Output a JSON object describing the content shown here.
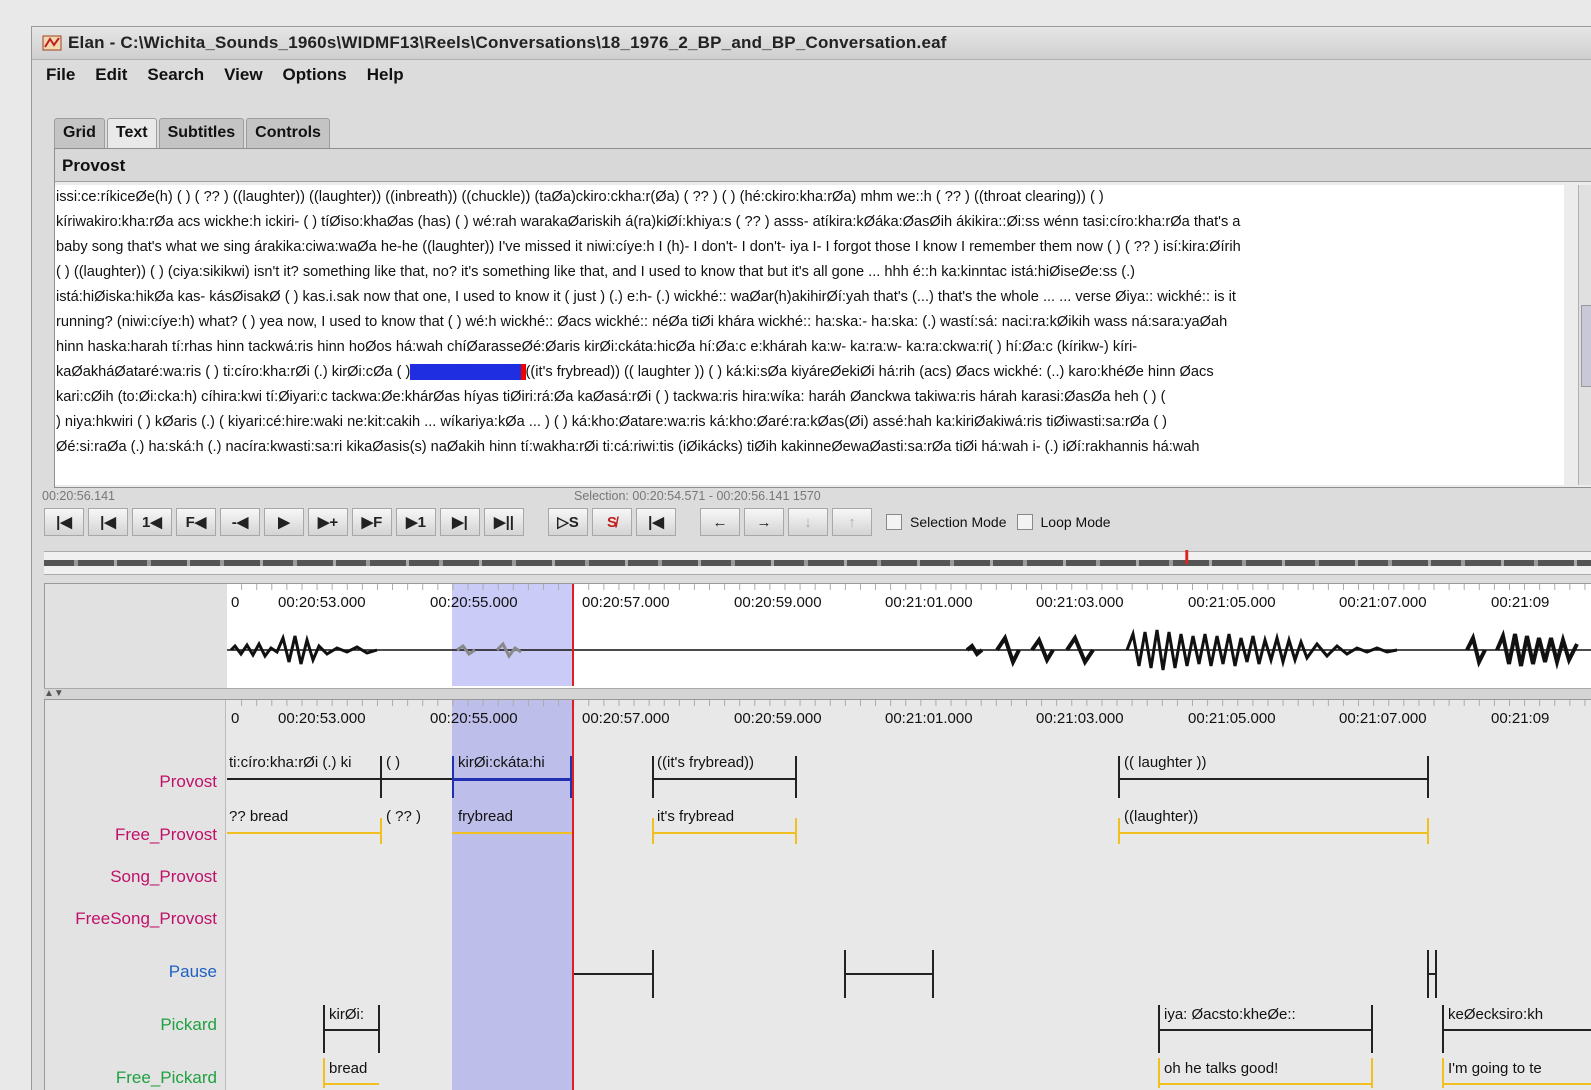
{
  "window": {
    "title": "Elan - C:\\Wichita_Sounds_1960s\\WIDMF13\\Reels\\Conversations\\18_1976_2_BP_and_BP_Conversation.eaf"
  },
  "menu": [
    "File",
    "Edit",
    "Search",
    "View",
    "Options",
    "Help"
  ],
  "tabs": [
    "Grid",
    "Text",
    "Subtitles",
    "Controls"
  ],
  "text_view": {
    "tier": "Provost",
    "lines": [
      "issi:ce:ríkiceØe(h) ( ) ( ?? ) ((laughter)) ((laughter)) ((inbreath)) ((chuckle)) (taØa)ckiro:ckha:r(Øa) ( ?? ) ( ) (hé:ckiro:kha:rØa) mhm we::h ( ?? ) ((throat clearing)) ( )",
      "kíriwakiro:kha:rØa acs wickhe:h ickiri- ( ) tíØiso:khaØas (has) ( ) wé:rah warakaØariskih á(ra)kiØí:khiya:s ( ?? ) asss- atíkira:kØáka:ØasØih ákikira::Øi:ss wénn tasi:círo:kha:rØa that's a",
      "baby song that's what we sing árakika:ciwa:waØa he-he ((laughter)) I've missed it niwi:cíye:h I (h)- I don't- I don't- iya I- I forgot those I know I remember them now ( ) ( ?? ) isí:kira:Øírih",
      "( ) ((laughter)) ( ) (ciya:sikikwi) isn't it? something like that, no? it's something like that, and I used to know that but it's all gone ... hhh é::h ka:kinntac istá:hiØiseØe:ss (.)",
      "istá:hiØiska:hikØa kas- kásØisakØ ( ) kas.i.sak now that one, I used to know it ( just ) (.) e:h- (.) wickhé:: waØar(h)akihirØí:yah that's (...) that's the whole ... ... verse Øiya:: wickhé:: is it",
      "running? (niwi:cíye:h) what? ( ) yea now, I used to know that ( ) wé:h wickhé:: Øacs wickhé:: néØa tiØi khára wickhé:: ha:ska:- ha:ska: (.) wastí:sá: naci:ra:kØikih wass ná:sara:yaØah",
      "hinn haska:harah tí:rhas hinn tackwá:ris hinn hoØos há:wah chíØarasseØé:Øaris kirØi:ckáta:hicØa hí:Øa:c e:khárah ka:w- ka:ra:w- ka:ra:ckwa:ri( ) hí:Øa:c (kírikw-) kíri-",
      "kaØakháØataré:wa:ris ( ) ti:círo:kha:rØi (.) kirØi:cØa ( )",
      "kari:cØih (to:Øi:cka:h) cíhira:kwi tí:Øiyari:c tackwa:Øe:khárØas híyas tiØiri:rá:Øa kaØasá:rØi ( ) tackwa:ris hira:wíka: haráh Øanckwa takiwa:ris hárah karasi:ØasØa heh ( ) (",
      " ) niya:hkwiri ( ) kØaris (.) ( kiyari:cé:hire:waki ne:kit:cakih ... wíkariya:kØa ... ) ( ) ká:kho:Øatare:wa:ris ká:kho:Øaré:ra:kØas(Øi) assé:hah ka:kiriØakiwá:ris tiØiwasti:sa:rØa ( )",
      "Øé:si:raØa (.) ha:ská:h (.) nacíra:kwasti:sa:ri kikaØasis(s) naØakih hinn tí:wakha:rØi ti:cá:riwi:tis (iØikácks) tiØih kakinneØewaØasti:sa:rØa tiØi há:wah i- (.) iØí:rakhannis há:wah"
    ],
    "selected_segment": "kirØi:ckáta:hicØa",
    "line8_after": "((it's frybread)) (( laughter )) ( ) ká:ki:sØa kiyáreØekiØi há:rih (acs) Øacs wickhé: (..) karo:khéØe hinn Øacs"
  },
  "status": {
    "time": "00:20:56.141",
    "selection": "Selection: 00:20:54.571 - 00:20:56.141 1570"
  },
  "controls": {
    "buttons": [
      "|◀",
      "|◀",
      "1◀",
      "F◀",
      "-◀",
      "▶",
      "▶+",
      "▶F",
      "▶1",
      "▶|",
      "▶||"
    ],
    "sel_buttons": [
      "▷S",
      "S̸",
      "|◀"
    ],
    "nav_buttons": [
      "←",
      "→",
      "↓",
      "↑"
    ],
    "selection_mode": "Selection Mode",
    "loop_mode": "Loop Mode"
  },
  "ruler_labels": [
    "00:20:53.000",
    "00:20:55.000",
    "00:20:57.000",
    "00:20:59.000",
    "00:21:01.000",
    "00:21:03.000",
    "00:21:05.000",
    "00:21:07.000",
    "00:21:09"
  ],
  "ruler_labels_tiers": [
    "00:20:53.000",
    "00:20:55.000",
    "00:20:57.000",
    "00:20:59.000",
    "00:21:01.000",
    "00:21:03.000",
    "00:21:05.000",
    "00:21:07.000",
    "00:21:09"
  ],
  "ruler_lead": "0",
  "tiers": [
    {
      "name": "Provost",
      "color": "#c0106a"
    },
    {
      "name": "Free_Provost",
      "color": "#c0106a"
    },
    {
      "name": "Song_Provost",
      "color": "#c0106a"
    },
    {
      "name": "FreeSong_Provost",
      "color": "#c0106a"
    },
    {
      "name": "Pause",
      "color": "#2060c0"
    },
    {
      "name": "Pickard",
      "color": "#20a040"
    },
    {
      "name": "Free_Pickard",
      "color": "#20a040"
    }
  ],
  "annotations": {
    "provost_1": "ti:círo:kha:rØi (.) ki",
    "provost_2": "( )",
    "provost_3": "kirØi:ckáta:hi",
    "provost_4": "((it's frybread))",
    "provost_5": "(( laughter ))",
    "free_1": "?? bread",
    "free_2": "( ?? )",
    "free_3": "frybread",
    "free_4": "it's frybread",
    "free_5": "((laughter))",
    "pickard_1": "kirØi:",
    "pickard_2": "iya: Øacsto:kheØe::",
    "pickard_3": "keØecksiro:kh",
    "fpickard_1": "bread",
    "fpickard_2": "oh he talks good!",
    "fpickard_3": "I'm going to te"
  }
}
